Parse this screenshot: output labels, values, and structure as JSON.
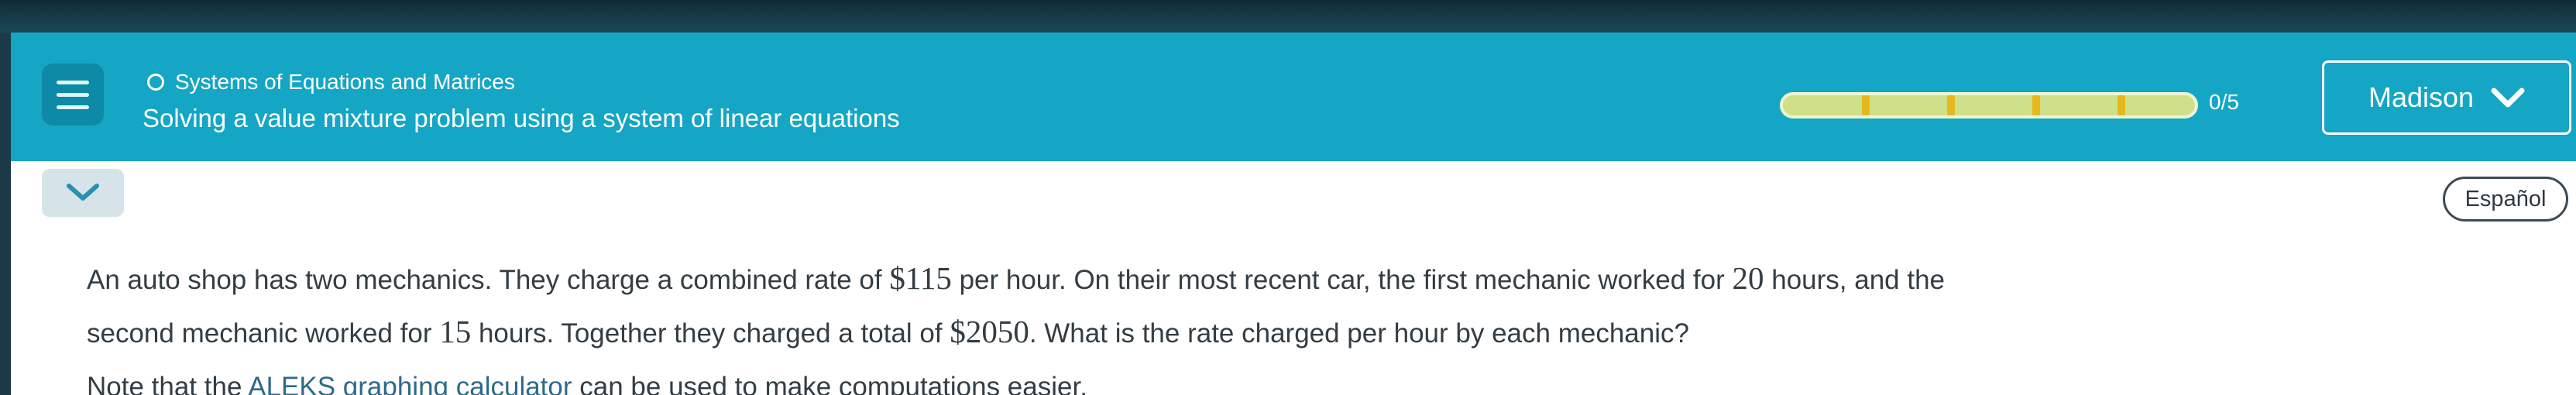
{
  "header": {
    "topic": "Systems of Equations and Matrices",
    "title": "Solving a value mixture problem using a system of linear equations",
    "progress_label": "0/5",
    "progress_value": 0,
    "progress_total": 5,
    "user_name": "Madison"
  },
  "language_button": "Español",
  "question": {
    "l1_a": "An auto shop has two mechanics. They charge a combined rate of ",
    "rate": "$115",
    "l1_b": " per hour. On their most recent car, the first mechanic worked for ",
    "hours1": "20",
    "l1_c": " hours, and the",
    "l2_a": "second mechanic worked for ",
    "hours2": "15",
    "l2_b": " hours. Together they charged a total of ",
    "total": "$2050",
    "l2_c": ". What is the rate charged per hour by each mechanic?"
  },
  "note": {
    "prefix": "Note that the ",
    "link": "ALEKS graphing calculator",
    "suffix": " can be used to make computations easier."
  },
  "colors": {
    "header_bg": "#14a6c4",
    "progress_fill": "#cfe08a",
    "progress_tick": "#e6b81e"
  },
  "icons": {
    "menu": "hamburger-icon",
    "topic": "circle-icon",
    "user_dropdown": "chevron-down-icon",
    "collapse": "chevron-down-icon"
  }
}
